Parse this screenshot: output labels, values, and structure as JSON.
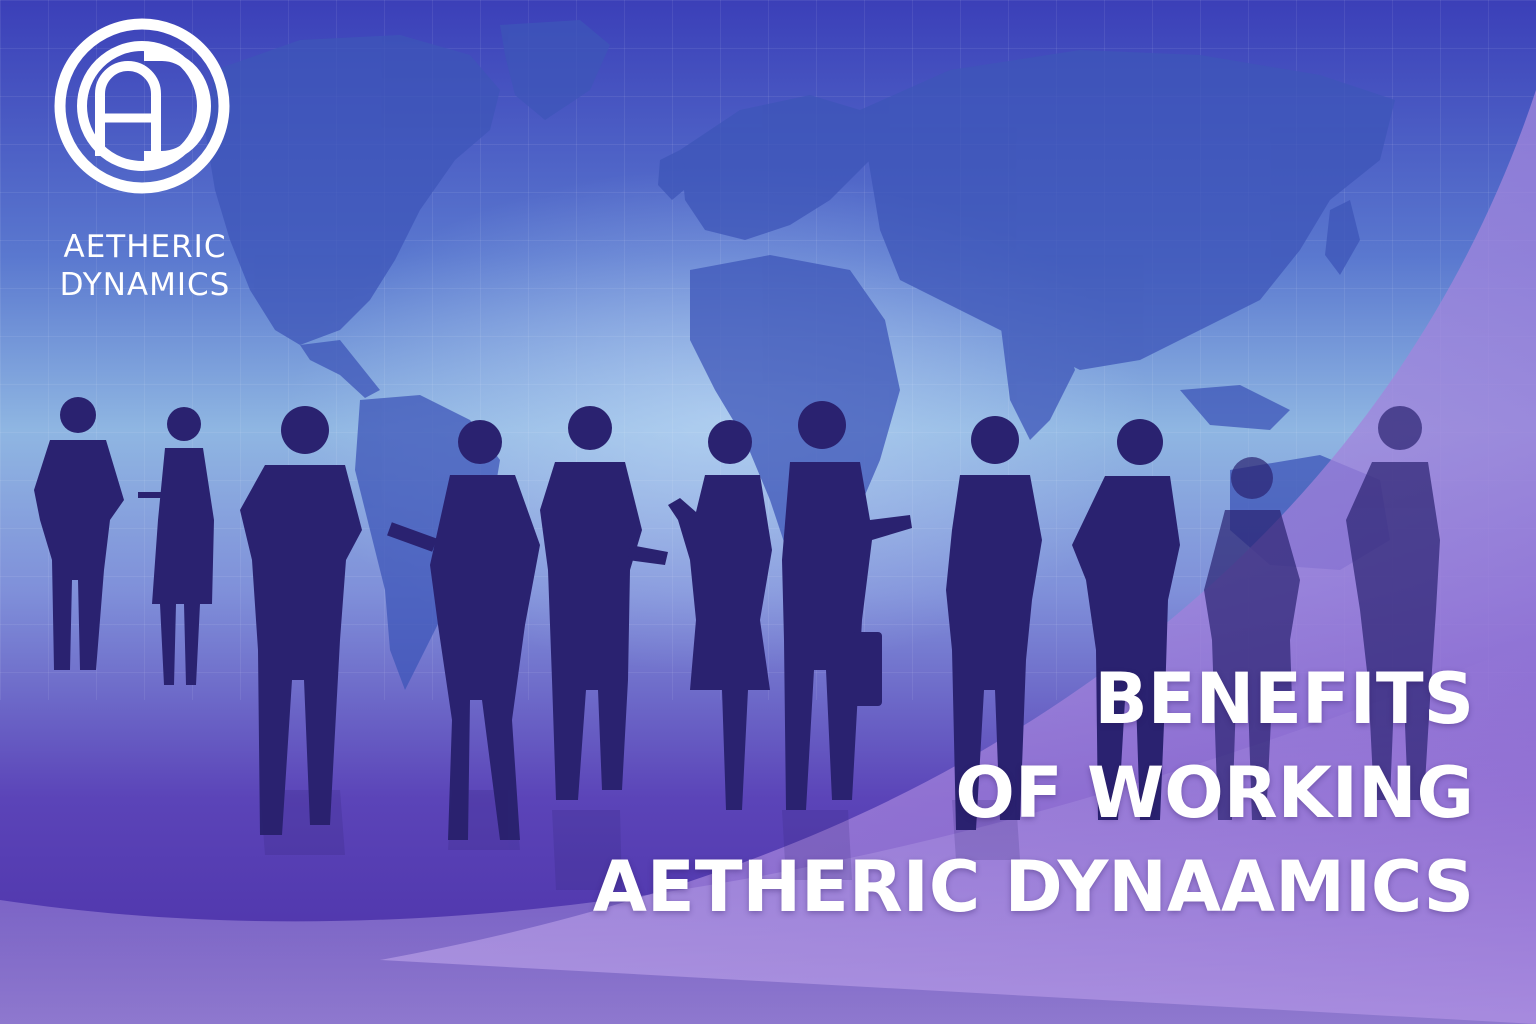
{
  "brand": {
    "logo_monogram": "AD",
    "name_line1": "AETHERIC",
    "name_line2": "DYNAMICS"
  },
  "headline": {
    "line1": "BENEFITS",
    "line2": "OF WORKING",
    "line3": "AETHERIC DYNAAMICS"
  },
  "colors": {
    "background_top": "#3b3fb8",
    "background_mid": "#8fb6e2",
    "background_bottom": "#4a2fa6",
    "silhouette": "#2a2270",
    "accent_swoosh": "#b9a3e6",
    "text": "#ffffff"
  },
  "icons": {
    "logo": "circle-ad-monogram-icon",
    "world_map": "world-map-icon",
    "people": "business-people-silhouettes"
  }
}
